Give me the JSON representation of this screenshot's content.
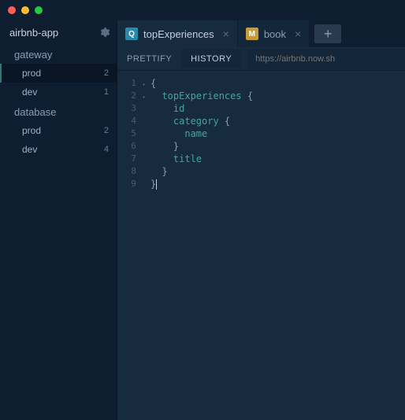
{
  "app": {
    "name": "airbnb-app"
  },
  "sidebar": {
    "groups": [
      {
        "label": "gateway",
        "items": [
          {
            "label": "prod",
            "count": "2",
            "active": true
          },
          {
            "label": "dev",
            "count": "1",
            "active": false
          }
        ]
      },
      {
        "label": "database",
        "items": [
          {
            "label": "prod",
            "count": "2",
            "active": false
          },
          {
            "label": "dev",
            "count": "4",
            "active": false
          }
        ]
      }
    ]
  },
  "tabs": [
    {
      "icon": "Q",
      "label": "topExperiences",
      "active": true
    },
    {
      "icon": "M",
      "label": "book",
      "active": false
    }
  ],
  "toolbar": {
    "prettify": "PRETTIFY",
    "history": "HISTORY",
    "url_placeholder": "https://airbnb.now.sh"
  },
  "editor": {
    "lines": [
      {
        "n": "1",
        "fold": true,
        "tokens": [
          {
            "t": "{",
            "c": "brace"
          }
        ]
      },
      {
        "n": "2",
        "fold": true,
        "tokens": [
          {
            "t": "  ",
            "c": ""
          },
          {
            "t": "topExperiences",
            "c": "field"
          },
          {
            "t": " {",
            "c": "brace"
          }
        ]
      },
      {
        "n": "3",
        "tokens": [
          {
            "t": "    ",
            "c": ""
          },
          {
            "t": "id",
            "c": "field2"
          }
        ]
      },
      {
        "n": "4",
        "tokens": [
          {
            "t": "    ",
            "c": ""
          },
          {
            "t": "category",
            "c": "field2"
          },
          {
            "t": " {",
            "c": "brace"
          }
        ]
      },
      {
        "n": "5",
        "tokens": [
          {
            "t": "      ",
            "c": ""
          },
          {
            "t": "name",
            "c": "field2"
          }
        ]
      },
      {
        "n": "6",
        "tokens": [
          {
            "t": "    ",
            "c": ""
          },
          {
            "t": "}",
            "c": "brace"
          }
        ]
      },
      {
        "n": "7",
        "tokens": [
          {
            "t": "    ",
            "c": ""
          },
          {
            "t": "title",
            "c": "field2"
          }
        ]
      },
      {
        "n": "8",
        "tokens": [
          {
            "t": "  ",
            "c": ""
          },
          {
            "t": "}",
            "c": "brace"
          }
        ]
      },
      {
        "n": "9",
        "tokens": [
          {
            "t": "}",
            "c": "brace"
          }
        ],
        "cursor": true
      }
    ]
  }
}
